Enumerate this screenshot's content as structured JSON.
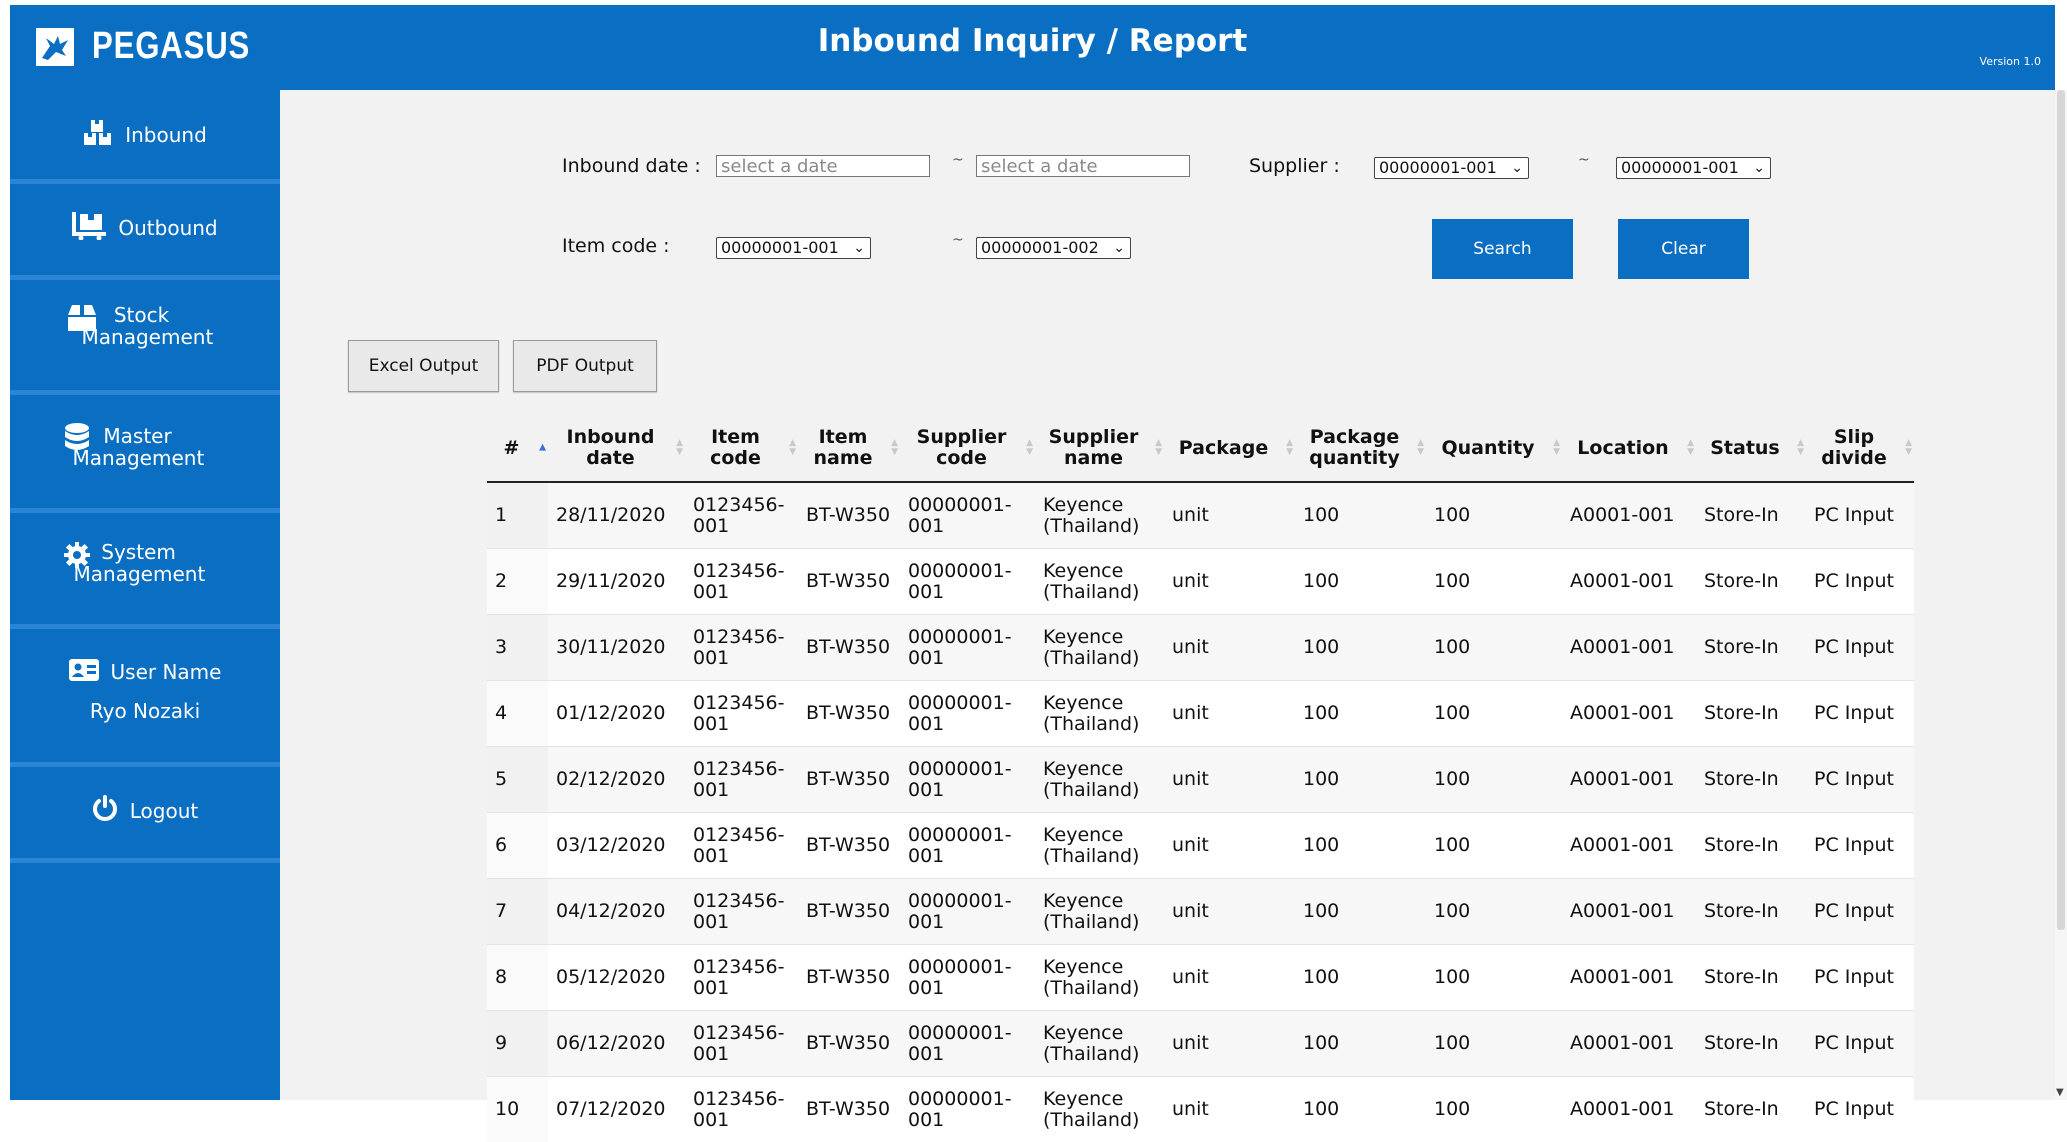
{
  "app": {
    "name": "PEGASUS",
    "title": "Inbound Inquiry / Report",
    "version": "Version 1.0"
  },
  "sidebar": {
    "items": [
      {
        "label": "Inbound",
        "icon": "boxes-icon"
      },
      {
        "label": "Outbound",
        "icon": "dolly-icon"
      },
      {
        "label": "Stock Management",
        "icon": "box-icon"
      },
      {
        "label": "Master Management",
        "icon": "database-icon"
      },
      {
        "label": "System Management",
        "icon": "gear-icon"
      },
      {
        "label": "User Name",
        "icon": "id-card-icon"
      },
      {
        "label": "Logout",
        "icon": "power-icon"
      }
    ],
    "user_name": "Ryo Nozaki"
  },
  "filters": {
    "inbound_date_label": "Inbound date :",
    "date_from_placeholder": "select a date",
    "date_to_placeholder": "select a date",
    "tilde": "~",
    "supplier_label": "Supplier :",
    "supplier_from": "00000001-001",
    "supplier_to": "00000001-001",
    "item_code_label": "Item code :",
    "item_code_from": "00000001-001",
    "item_code_to": "00000001-002",
    "search_label": "Search",
    "clear_label": "Clear"
  },
  "actions": {
    "excel_label": "Excel Output",
    "pdf_label": "PDF Output"
  },
  "table": {
    "columns": [
      {
        "line1": "#",
        "line2": ""
      },
      {
        "line1": "Inbound",
        "line2": "date"
      },
      {
        "line1": "Item",
        "line2": "code"
      },
      {
        "line1": "Item",
        "line2": "name"
      },
      {
        "line1": "Supplier",
        "line2": "code"
      },
      {
        "line1": "Supplier",
        "line2": "name"
      },
      {
        "line1": "Package",
        "line2": ""
      },
      {
        "line1": "Package",
        "line2": "quantity"
      },
      {
        "line1": "Quantity",
        "line2": ""
      },
      {
        "line1": "Location",
        "line2": ""
      },
      {
        "line1": "Status",
        "line2": ""
      },
      {
        "line1": "Slip",
        "line2": "divide"
      }
    ],
    "rows": [
      [
        "1",
        "28/11/2020",
        "0123456-001",
        "BT-W350",
        "00000001-001",
        "Keyence (Thailand)",
        "unit",
        "100",
        "100",
        "A0001-001",
        "Store-In",
        "PC Input"
      ],
      [
        "2",
        "29/11/2020",
        "0123456-001",
        "BT-W350",
        "00000001-001",
        "Keyence (Thailand)",
        "unit",
        "100",
        "100",
        "A0001-001",
        "Store-In",
        "PC Input"
      ],
      [
        "3",
        "30/11/2020",
        "0123456-001",
        "BT-W350",
        "00000001-001",
        "Keyence (Thailand)",
        "unit",
        "100",
        "100",
        "A0001-001",
        "Store-In",
        "PC Input"
      ],
      [
        "4",
        "01/12/2020",
        "0123456-001",
        "BT-W350",
        "00000001-001",
        "Keyence (Thailand)",
        "unit",
        "100",
        "100",
        "A0001-001",
        "Store-In",
        "PC Input"
      ],
      [
        "5",
        "02/12/2020",
        "0123456-001",
        "BT-W350",
        "00000001-001",
        "Keyence (Thailand)",
        "unit",
        "100",
        "100",
        "A0001-001",
        "Store-In",
        "PC Input"
      ],
      [
        "6",
        "03/12/2020",
        "0123456-001",
        "BT-W350",
        "00000001-001",
        "Keyence (Thailand)",
        "unit",
        "100",
        "100",
        "A0001-001",
        "Store-In",
        "PC Input"
      ],
      [
        "7",
        "04/12/2020",
        "0123456-001",
        "BT-W350",
        "00000001-001",
        "Keyence (Thailand)",
        "unit",
        "100",
        "100",
        "A0001-001",
        "Store-In",
        "PC Input"
      ],
      [
        "8",
        "05/12/2020",
        "0123456-001",
        "BT-W350",
        "00000001-001",
        "Keyence (Thailand)",
        "unit",
        "100",
        "100",
        "A0001-001",
        "Store-In",
        "PC Input"
      ],
      [
        "9",
        "06/12/2020",
        "0123456-001",
        "BT-W350",
        "00000001-001",
        "Keyence (Thailand)",
        "unit",
        "100",
        "100",
        "A0001-001",
        "Store-In",
        "PC Input"
      ],
      [
        "10",
        "07/12/2020",
        "0123456-001",
        "BT-W350",
        "00000001-001",
        "Keyence (Thailand)",
        "unit",
        "100",
        "100",
        "A0001-001",
        "Store-In",
        "PC Input"
      ]
    ]
  },
  "colors": {
    "primary": "#0a6fc2",
    "content_bg": "#f2f2f2",
    "sort_active": "#3a6fd8"
  }
}
